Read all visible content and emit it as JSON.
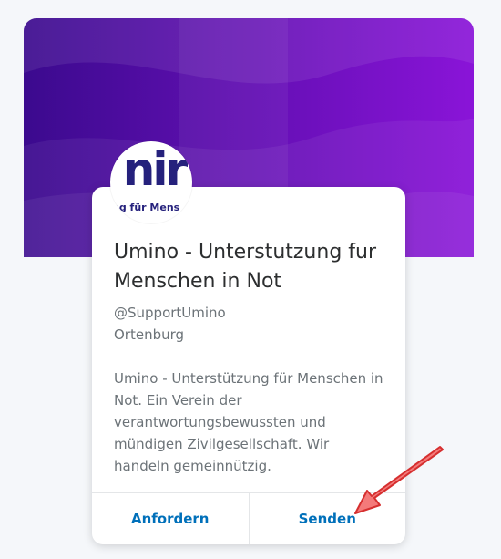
{
  "colors": {
    "banner_dark": "#3b0a8e",
    "banner_light": "#8a14d8",
    "link_blue": "#0070ba",
    "logo_navy": "#25217c",
    "arrow_fill": "#f47a7a",
    "arrow_stroke": "#d62f2f"
  },
  "profile": {
    "logo_text": "nir",
    "logo_subtext": "ng für Mens",
    "name": "Umino - Unterstutzung fur Menschen in Not",
    "handle": "@SupportUmino",
    "location": "Ortenburg",
    "description": "Umino - Unterstützung für Menschen in Not. Ein Verein der verantwortungsbewussten und mündigen Zivilgesellschaft. Wir handeln gemeinnützig."
  },
  "actions": {
    "request_label": "Anfordern",
    "send_label": "Senden"
  },
  "annotation": {
    "icon": "red-arrow-icon"
  }
}
